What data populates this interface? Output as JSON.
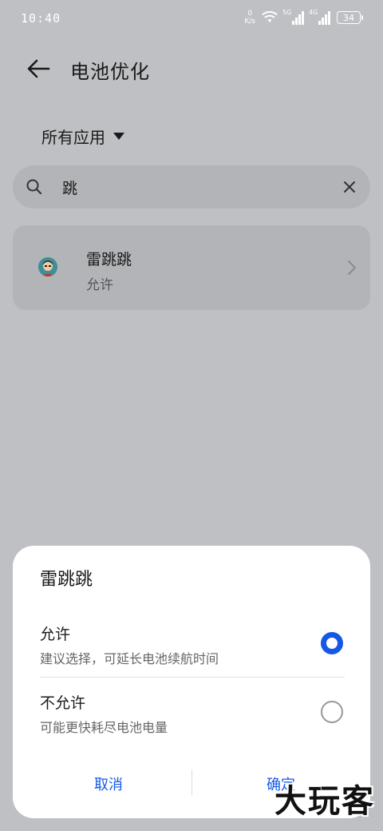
{
  "status_bar": {
    "time": "10:40",
    "speed_value": "0",
    "speed_unit": "K/s",
    "net1": "5G",
    "net2": "4G",
    "battery": "34"
  },
  "header": {
    "title": "电池优化"
  },
  "filter": {
    "label": "所有应用"
  },
  "search": {
    "value": "跳"
  },
  "app_item": {
    "name": "雷跳跳",
    "status": "允许"
  },
  "sheet": {
    "title": "雷跳跳",
    "options": [
      {
        "label": "允许",
        "desc": "建议选择，可延长电池续航时间",
        "selected": true
      },
      {
        "label": "不允许",
        "desc": "可能更快耗尽电池电量",
        "selected": false
      }
    ],
    "cancel": "取消",
    "confirm": "确定"
  },
  "watermark": "大玩客",
  "colors": {
    "accent": "#1558e6",
    "overlay_bg": "#bfc0c3"
  }
}
